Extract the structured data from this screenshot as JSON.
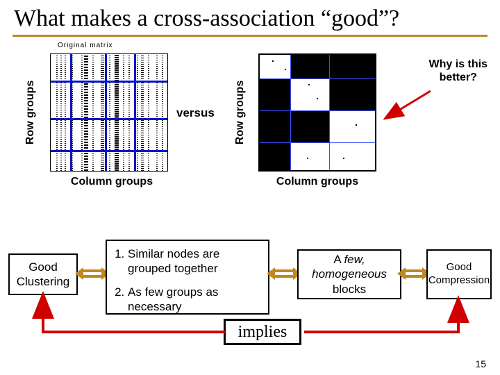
{
  "title": "What makes a cross-association “good”?",
  "matrix_caption": "Original matrix",
  "row_label": "Row groups",
  "col_label": "Column groups",
  "versus": "versus",
  "why": "Why is this\nbetter?",
  "good_clustering": "Good\nClustering",
  "criteria": {
    "c1": "Similar nodes are grouped together",
    "c2": "As few groups as necessary"
  },
  "blocks": {
    "line1_prefix": "A ",
    "line1_em": "few,",
    "line2_em": "homogeneous",
    "line3": "blocks"
  },
  "compression": "Good\nCompression",
  "implies": "implies",
  "slide_number": "15"
}
